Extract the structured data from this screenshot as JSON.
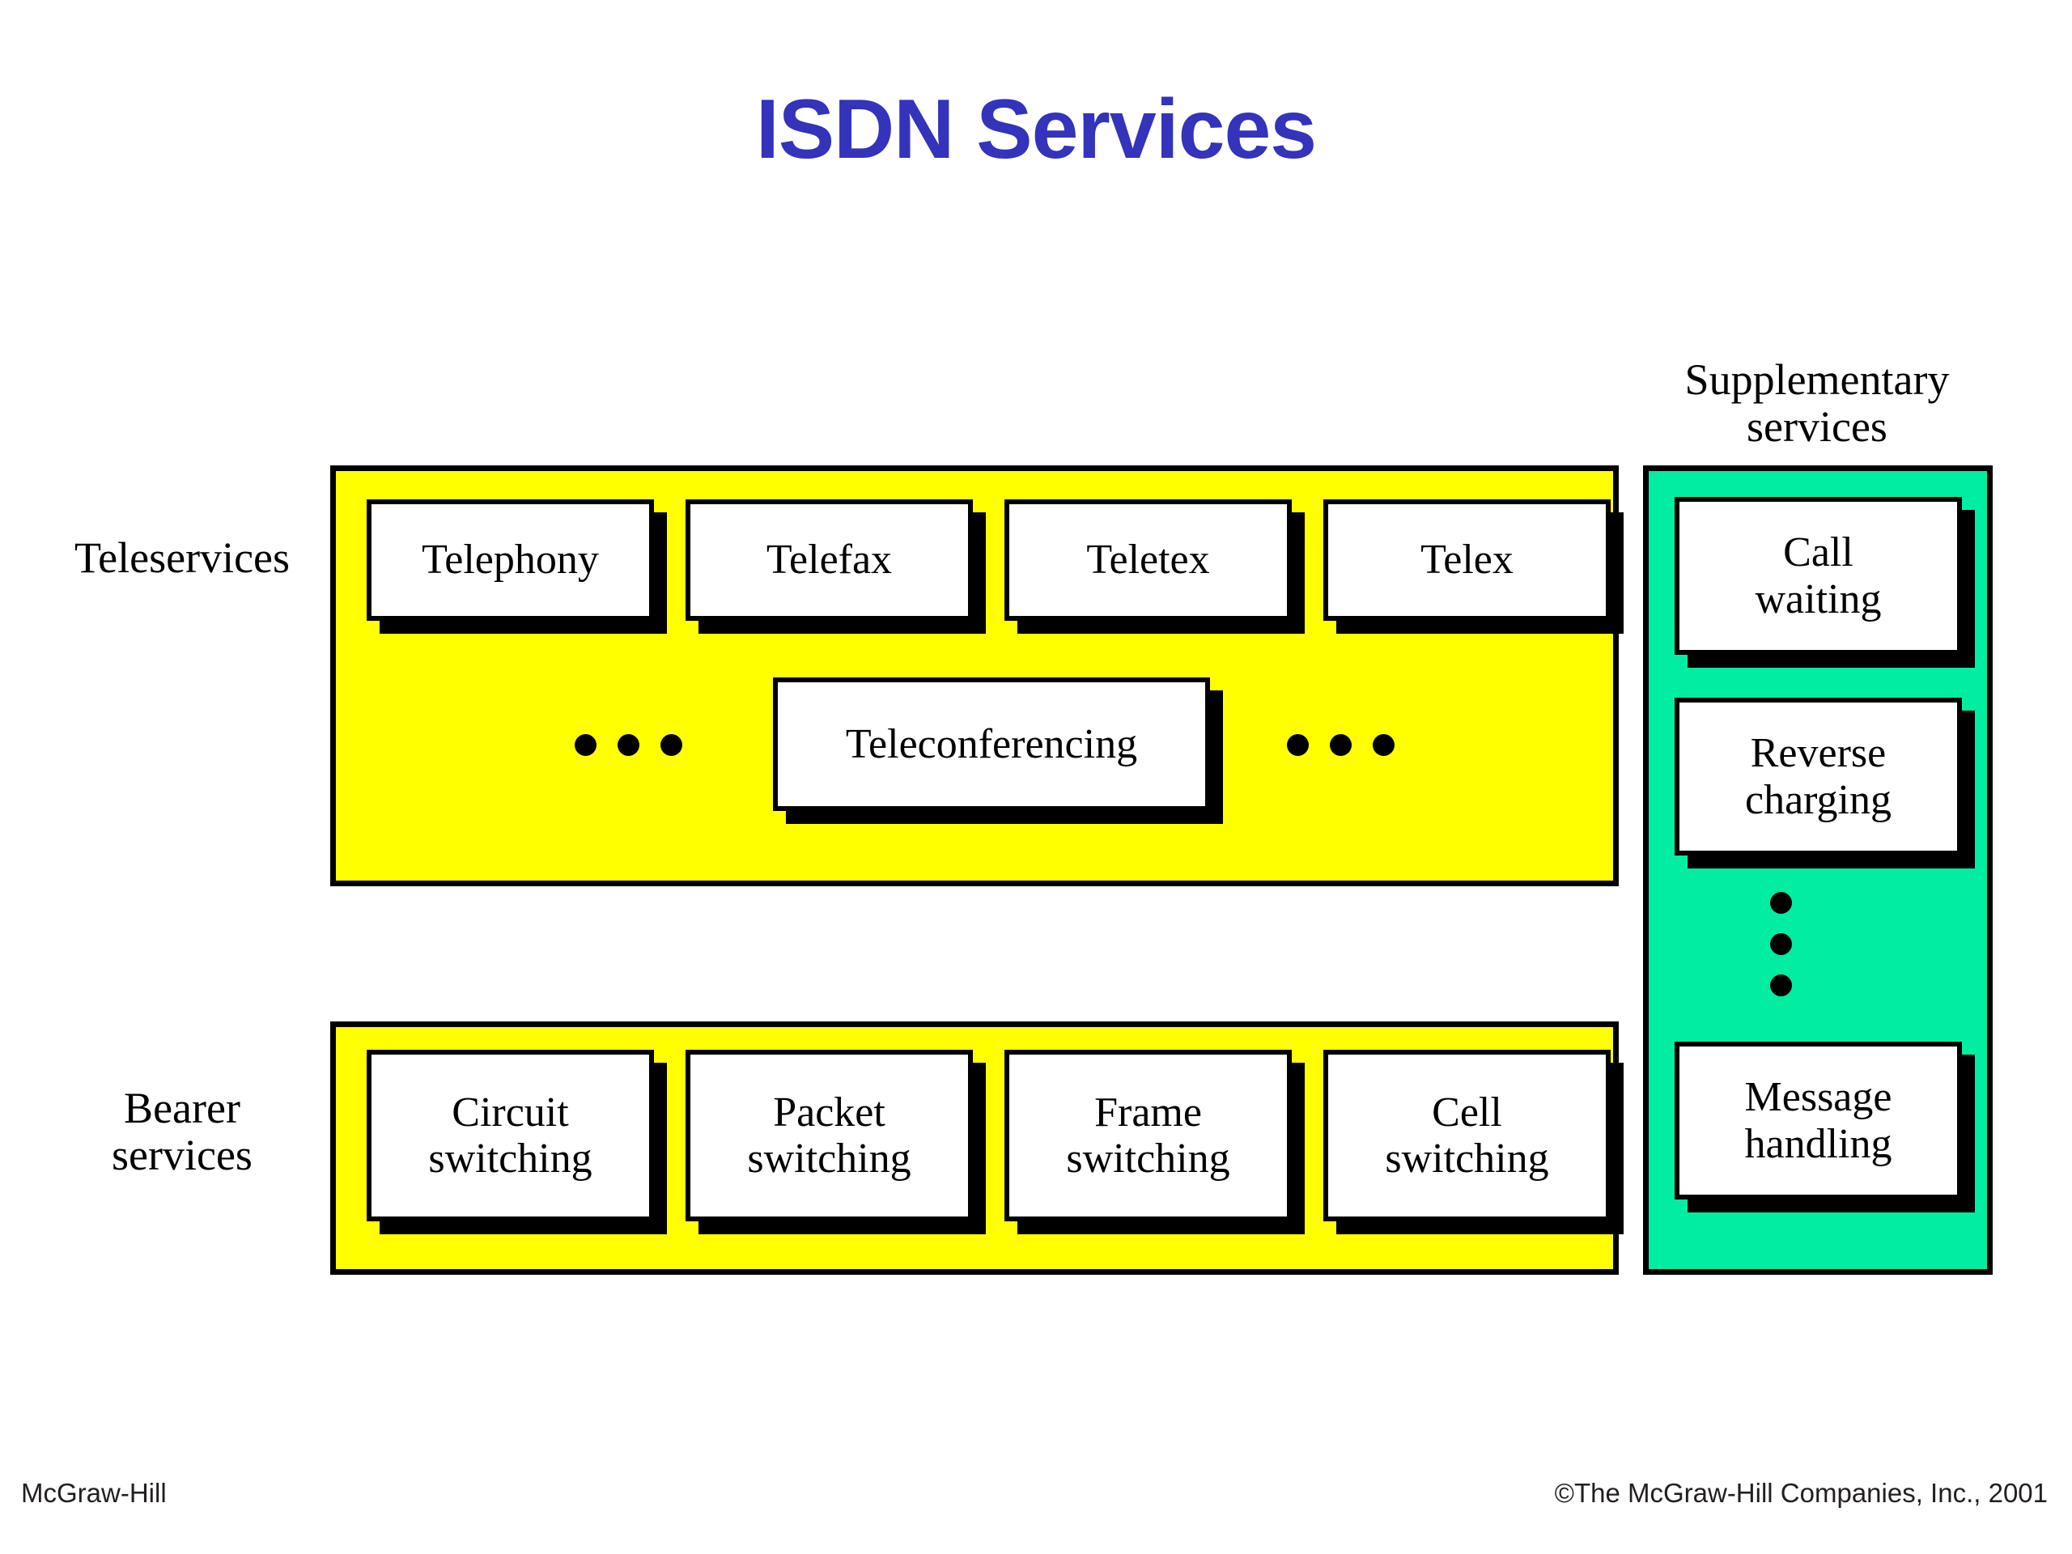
{
  "slide": {
    "title": "ISDN Services",
    "title_color": "#3333bb",
    "background_color": "#ffffff"
  },
  "colors": {
    "teleservices_panel": "#ffff00",
    "bearer_panel": "#ffff00",
    "supplementary_panel": "#00eda2",
    "box_fill": "#ffffff",
    "outline": "#000000",
    "shadow": "#000000"
  },
  "labels": {
    "teleservices": "Teleservices",
    "bearer_services": "Bearer\nservices",
    "supplementary_services": "Supplementary\nservices"
  },
  "teleservices": {
    "row_label": "Teleservices",
    "top_row": [
      {
        "name": "Telephony"
      },
      {
        "name": "Telefax"
      },
      {
        "name": "Teletex"
      },
      {
        "name": "Telex"
      }
    ],
    "bottom_row": [
      {
        "name": "Teleconferencing"
      }
    ],
    "ellipsis_left_dots": 3,
    "ellipsis_right_dots": 3
  },
  "bearer_services": {
    "row_label": "Bearer\nservices",
    "items": [
      {
        "name": "Circuit\nswitching"
      },
      {
        "name": "Packet\nswitching"
      },
      {
        "name": "Frame\nswitching"
      },
      {
        "name": "Cell\nswitching"
      }
    ]
  },
  "supplementary_services": {
    "heading": "Supplementary\nservices",
    "items": [
      {
        "name": "Call\nwaiting"
      },
      {
        "name": "Reverse\ncharging"
      },
      {
        "name": "Message\nhandling"
      }
    ],
    "ellipsis_dots": 3
  },
  "footer": {
    "left": "McGraw-Hill",
    "right": "©The McGraw-Hill Companies, Inc., 2001"
  }
}
